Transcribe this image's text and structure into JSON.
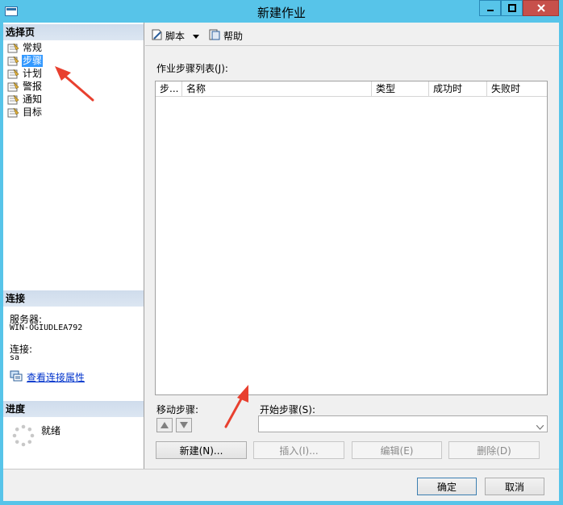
{
  "window": {
    "title": "新建作业",
    "icons": {
      "app": "window-app-icon",
      "minimize": "minimize-icon",
      "maximize": "maximize-icon",
      "close": "close-icon"
    }
  },
  "left_pane": {
    "select_page_header": "选择页",
    "nav_items": [
      {
        "label": "常规",
        "icon": "page-icon"
      },
      {
        "label": "步骤",
        "icon": "page-icon",
        "selected": true
      },
      {
        "label": "计划",
        "icon": "page-icon"
      },
      {
        "label": "警报",
        "icon": "page-icon"
      },
      {
        "label": "通知",
        "icon": "page-icon"
      },
      {
        "label": "目标",
        "icon": "page-icon"
      }
    ],
    "connection": {
      "header": "连接",
      "server_label": "服务器:",
      "server_value": "WIN-OGIUDLEA792",
      "connection_label": "连接:",
      "connection_value": "sa",
      "view_link": "查看连接属性"
    },
    "progress": {
      "header": "进度",
      "status": "就绪"
    }
  },
  "toolbar": {
    "script_label": "脚本",
    "help_label": "帮助"
  },
  "steps": {
    "list_label": "作业步骤列表(J):",
    "columns": [
      "步...",
      "名称",
      "类型",
      "成功时",
      "失败时"
    ],
    "rows": []
  },
  "move_step": {
    "label": "移动步骤:"
  },
  "start_step": {
    "label": "开始步骤(S):",
    "value": ""
  },
  "actions": {
    "new": "新建(N)...",
    "insert": "插入(I)...",
    "edit": "编辑(E)",
    "delete": "删除(D)"
  },
  "dialog": {
    "ok": "确定",
    "cancel": "取消"
  },
  "colors": {
    "title_bar": "#57c4e9",
    "close_button": "#c7504b",
    "selection": "#3399ff",
    "annotation_arrow": "#e8402f"
  }
}
